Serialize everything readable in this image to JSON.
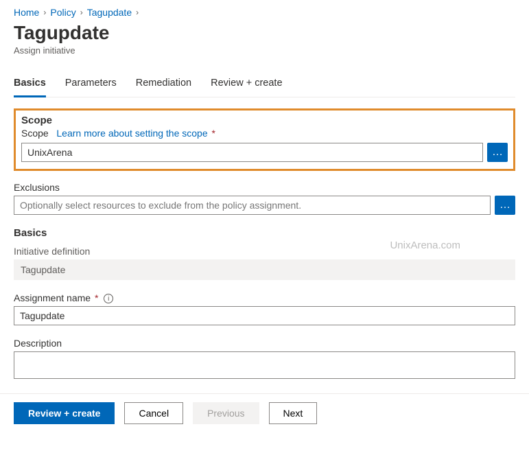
{
  "breadcrumb": {
    "items": [
      "Home",
      "Policy",
      "Tagupdate"
    ]
  },
  "header": {
    "title": "Tagupdate",
    "subtitle": "Assign initiative"
  },
  "tabs": [
    {
      "label": "Basics",
      "active": true
    },
    {
      "label": "Parameters",
      "active": false
    },
    {
      "label": "Remediation",
      "active": false
    },
    {
      "label": "Review + create",
      "active": false
    }
  ],
  "scope": {
    "heading": "Scope",
    "label": "Scope",
    "learn_more": "Learn more about setting the scope",
    "value": "UnixArena"
  },
  "exclusions": {
    "label": "Exclusions",
    "placeholder": "Optionally select resources to exclude from the policy assignment."
  },
  "basics": {
    "heading": "Basics",
    "initiative_label": "Initiative definition",
    "initiative_value": "Tagupdate",
    "assignment_label": "Assignment name",
    "assignment_value": "Tagupdate",
    "description_label": "Description",
    "description_value": ""
  },
  "watermark": "UnixArena.com",
  "footer": {
    "review": "Review + create",
    "cancel": "Cancel",
    "previous": "Previous",
    "next": "Next"
  }
}
